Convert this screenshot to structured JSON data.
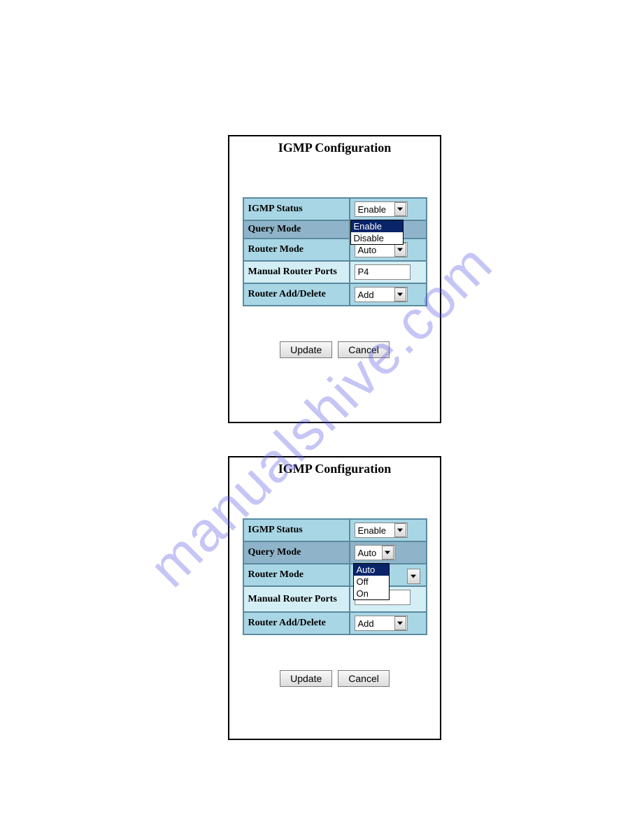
{
  "watermark": "manualshive.com",
  "panel1": {
    "title": "IGMP Configuration",
    "rows": {
      "igmp_status": {
        "label": "IGMP Status",
        "value": "Enable"
      },
      "query_mode": {
        "label": "Query Mode",
        "dropdown_open": true,
        "options": [
          "Enable",
          "Disable"
        ],
        "highlighted": "Enable"
      },
      "router_mode": {
        "label": "Router Mode",
        "value": "Auto"
      },
      "manual_ports": {
        "label": "Manual Router Ports",
        "value": "P4"
      },
      "router_adddel": {
        "label": "Router Add/Delete",
        "value": "Add"
      }
    },
    "buttons": {
      "update": "Update",
      "cancel": "Cancel"
    }
  },
  "panel2": {
    "title": "IGMP Configuration",
    "rows": {
      "igmp_status": {
        "label": "IGMP Status",
        "value": "Enable"
      },
      "query_mode": {
        "label": "Query Mode",
        "value": "Auto"
      },
      "router_mode": {
        "label": "Router Mode",
        "dropdown_open": true,
        "options": [
          "Auto",
          "Off",
          "On"
        ],
        "highlighted": "Auto"
      },
      "manual_ports": {
        "label": "Manual Router Ports",
        "value": ""
      },
      "router_adddel": {
        "label": "Router Add/Delete",
        "value": "Add"
      }
    },
    "buttons": {
      "update": "Update",
      "cancel": "Cancel"
    }
  }
}
